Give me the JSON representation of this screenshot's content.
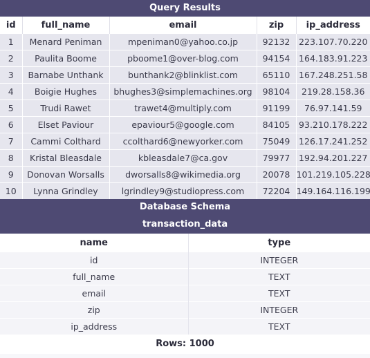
{
  "query_results": {
    "title": "Query Results",
    "columns": [
      "id",
      "full_name",
      "email",
      "zip",
      "ip_address"
    ],
    "rows": [
      [
        "1",
        "Menard Peniman",
        "mpeniman0@yahoo.co.jp",
        "92132",
        "223.107.70.220"
      ],
      [
        "2",
        "Paulita Boome",
        "pboome1@over-blog.com",
        "94154",
        "164.183.91.223"
      ],
      [
        "3",
        "Barnabe Unthank",
        "bunthank2@blinklist.com",
        "65110",
        "167.248.251.58"
      ],
      [
        "4",
        "Boigie Hughes",
        "bhughes3@simplemachines.org",
        "98104",
        "219.28.158.36"
      ],
      [
        "5",
        "Trudi Rawet",
        "trawet4@multiply.com",
        "91199",
        "76.97.141.59"
      ],
      [
        "6",
        "Elset Paviour",
        "epaviour5@google.com",
        "84105",
        "93.210.178.222"
      ],
      [
        "7",
        "Cammi Colthard",
        "ccolthard6@newyorker.com",
        "75049",
        "126.17.241.252"
      ],
      [
        "8",
        "Kristal Bleasdale",
        "kbleasdale7@ca.gov",
        "79977",
        "192.94.201.227"
      ],
      [
        "9",
        "Donovan Worsalls",
        "dworsalls8@wikimedia.org",
        "20078",
        "101.219.105.228"
      ],
      [
        "10",
        "Lynna Grindley",
        "lgrindley9@studiopress.com",
        "72204",
        "149.164.116.199"
      ]
    ]
  },
  "schema": {
    "title": "Database Schema",
    "table_name": "transaction_data",
    "columns": [
      "name",
      "type"
    ],
    "fields": [
      [
        "id",
        "INTEGER"
      ],
      [
        "full_name",
        "TEXT"
      ],
      [
        "email",
        "TEXT"
      ],
      [
        "zip",
        "INTEGER"
      ],
      [
        "ip_address",
        "TEXT"
      ]
    ]
  },
  "footer": {
    "rows_label": "Rows: 1000"
  },
  "colors": {
    "header_band": "#4e4a73",
    "row_bg": "#e6e6ee"
  }
}
